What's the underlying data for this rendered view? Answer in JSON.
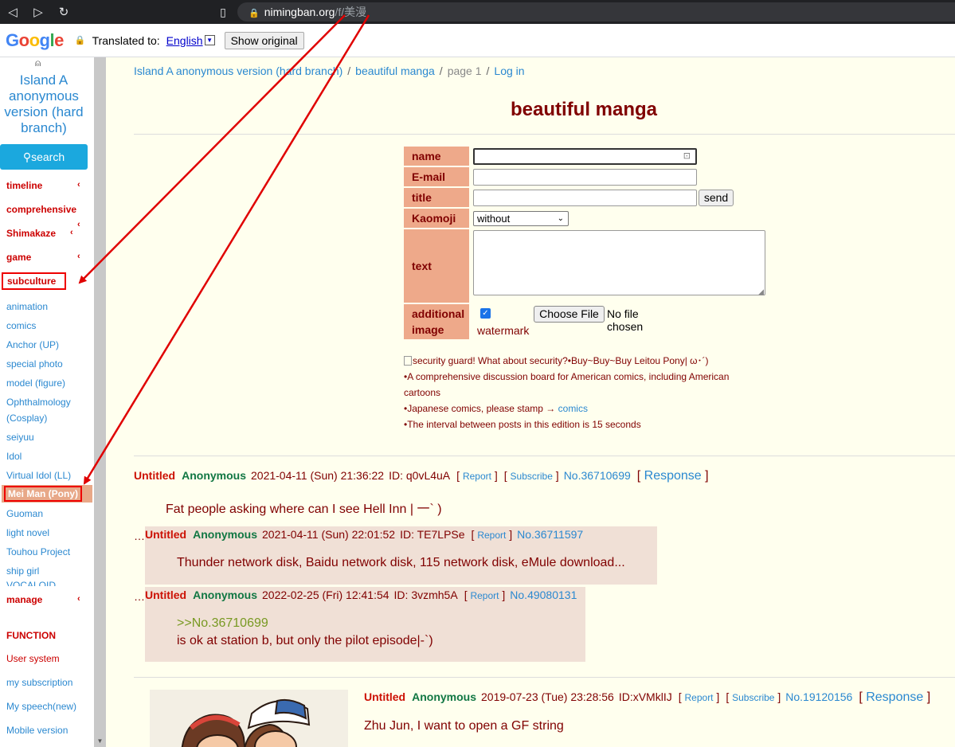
{
  "browser": {
    "url_host": "nimingban.org",
    "url_path": "/f/美漫"
  },
  "translate_bar": {
    "logo_letters": [
      "G",
      "o",
      "o",
      "g",
      "l",
      "e"
    ],
    "translated_to_label": "Translated to:",
    "language": "English",
    "show_original_label": "Show original"
  },
  "sidebar": {
    "site_title": "Island A anonymous version (hard branch)",
    "search_label": "search",
    "categories": {
      "timeline": "timeline",
      "comprehensive": "comprehensive",
      "shimakaze": "Shimakaze",
      "game": "game",
      "subculture": "subculture",
      "manage": "manage",
      "function": "FUNCTION"
    },
    "subculture_items": [
      "animation",
      "comics",
      "Anchor (UP)",
      "special photo",
      "model (figure)",
      "Ophthalmology",
      "(Cosplay)",
      "seiyuu",
      "Idol",
      "Virtual Idol (LL)",
      "Mei Man (Pony)",
      "Guoman",
      "light novel",
      "Touhou Project",
      "ship girl",
      "VOCALOID"
    ],
    "function_items": [
      "User system",
      "my subscription",
      "My speech(new)",
      "Mobile version"
    ]
  },
  "breadcrumb": {
    "home": "Island A anonymous version (hard branch)",
    "board": "beautiful manga",
    "page": "page 1",
    "login": "Log in"
  },
  "page_title": "beautiful manga",
  "form": {
    "name_label": "name",
    "email_label": "E-mail",
    "title_label": "title",
    "send_label": "send",
    "kaomoji_label": "Kaomoji",
    "kaomoji_value": "without",
    "text_label": "text",
    "image_label_1": "additional",
    "image_label_2": "image",
    "choose_file_label": "Choose File",
    "no_file_label": "No file chosen",
    "watermark_label": "watermark"
  },
  "notes": {
    "security": "security guard! What about security?•Buy~Buy~Buy Leitou Pony| ω･´)",
    "line1": "•A comprehensive discussion board for American comics, including American cartoons",
    "line2_prefix": "•Japanese comics, please stamp →",
    "line2_link": "comics",
    "line3": "•The interval between posts in this edition is 15 seconds"
  },
  "common": {
    "report": "Report",
    "subscribe": "Subscribe",
    "response": "Response",
    "ellipsis": "…"
  },
  "posts": [
    {
      "title": "Untitled",
      "name": "Anonymous",
      "time": "2021-04-11 (Sun) 21:36:22",
      "id": "ID: q0vL4uA",
      "no": "No.36710699",
      "text": "Fat people asking where can I see Hell Inn | 一` )",
      "replies": [
        {
          "title": "Untitled",
          "name": "Anonymous",
          "time": "2021-04-11 (Sun) 22:01:52",
          "id": "ID: TE7LPSe",
          "no": "No.36711597",
          "text": "Thunder network disk, Baidu network disk, 115 network disk, eMule download..."
        },
        {
          "title": "Untitled",
          "name": "Anonymous",
          "time": "2022-02-25 (Fri) 12:41:54",
          "id": "ID: 3vzmh5A",
          "no": "No.49080131",
          "quote": ">>No.36710699",
          "text": "is ok at station b, but only the pilot episode|-`)"
        }
      ]
    },
    {
      "title": "Untitled",
      "name": "Anonymous",
      "time": "2019-07-23 (Tue) 23:28:56",
      "id": "ID:xVMklIJ",
      "no": "No.19120156",
      "text": "Zhu Jun, I want to open a GF string"
    }
  ],
  "colors": {
    "link": "#2a88d0",
    "maroon": "#800000",
    "label_bg": "#eea98a",
    "annotation": "#e00000"
  }
}
